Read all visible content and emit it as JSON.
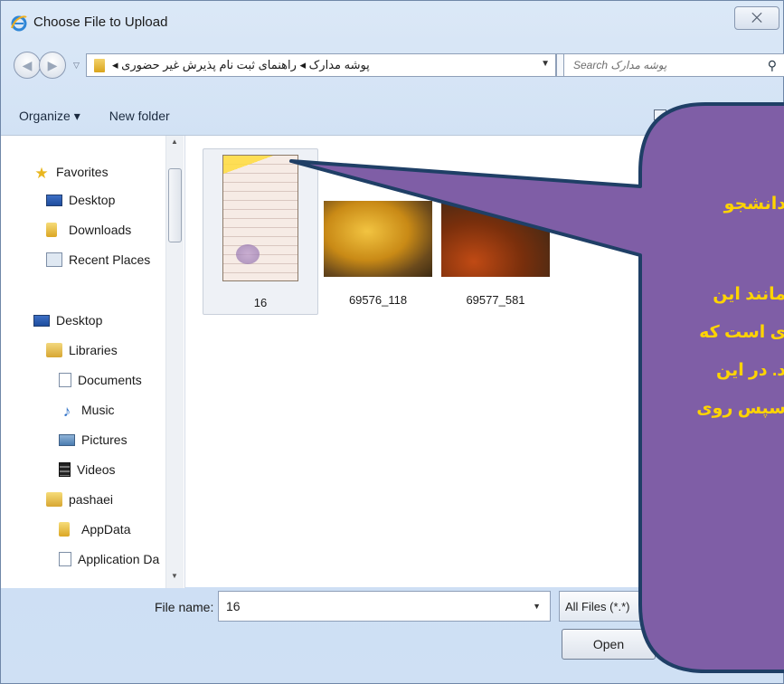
{
  "window": {
    "title": "Choose File to Upload",
    "close_glyph": "⨉"
  },
  "address": {
    "breadcrumb": "پوشه مدارک ◂ راهنمای ثبت نام پذیرش غیر حضوری ◂",
    "search_placeholder": "پوشه مدارک Search"
  },
  "toolbar": {
    "organize": "Organize ▾",
    "new_folder": "New folder"
  },
  "nav": {
    "favorites": "Favorites",
    "desktop_fav": "Desktop",
    "downloads": "Downloads",
    "recent": "Recent Places",
    "desktop": "Desktop",
    "libraries": "Libraries",
    "documents": "Documents",
    "music": "Music",
    "pictures": "Pictures",
    "videos": "Videos",
    "user": "pashaei",
    "appdata": "AppData",
    "application_data": "Application Da"
  },
  "files": [
    {
      "name": "16"
    },
    {
      "name": "69576_118"
    },
    {
      "name": "69577_581"
    }
  ],
  "bottom": {
    "file_name_label": "File name:",
    "file_name_value": "16",
    "file_type": "All Files (*.*)",
    "open": "Open"
  },
  "callout": {
    "title": "دانشجو",
    "lines": [
      "مانند این",
      "ی است که",
      "د. در این",
      "سپس روی"
    ],
    "fill": "#7f5ea6",
    "border": "#1f3f66",
    "text_color": "#ffd400"
  }
}
